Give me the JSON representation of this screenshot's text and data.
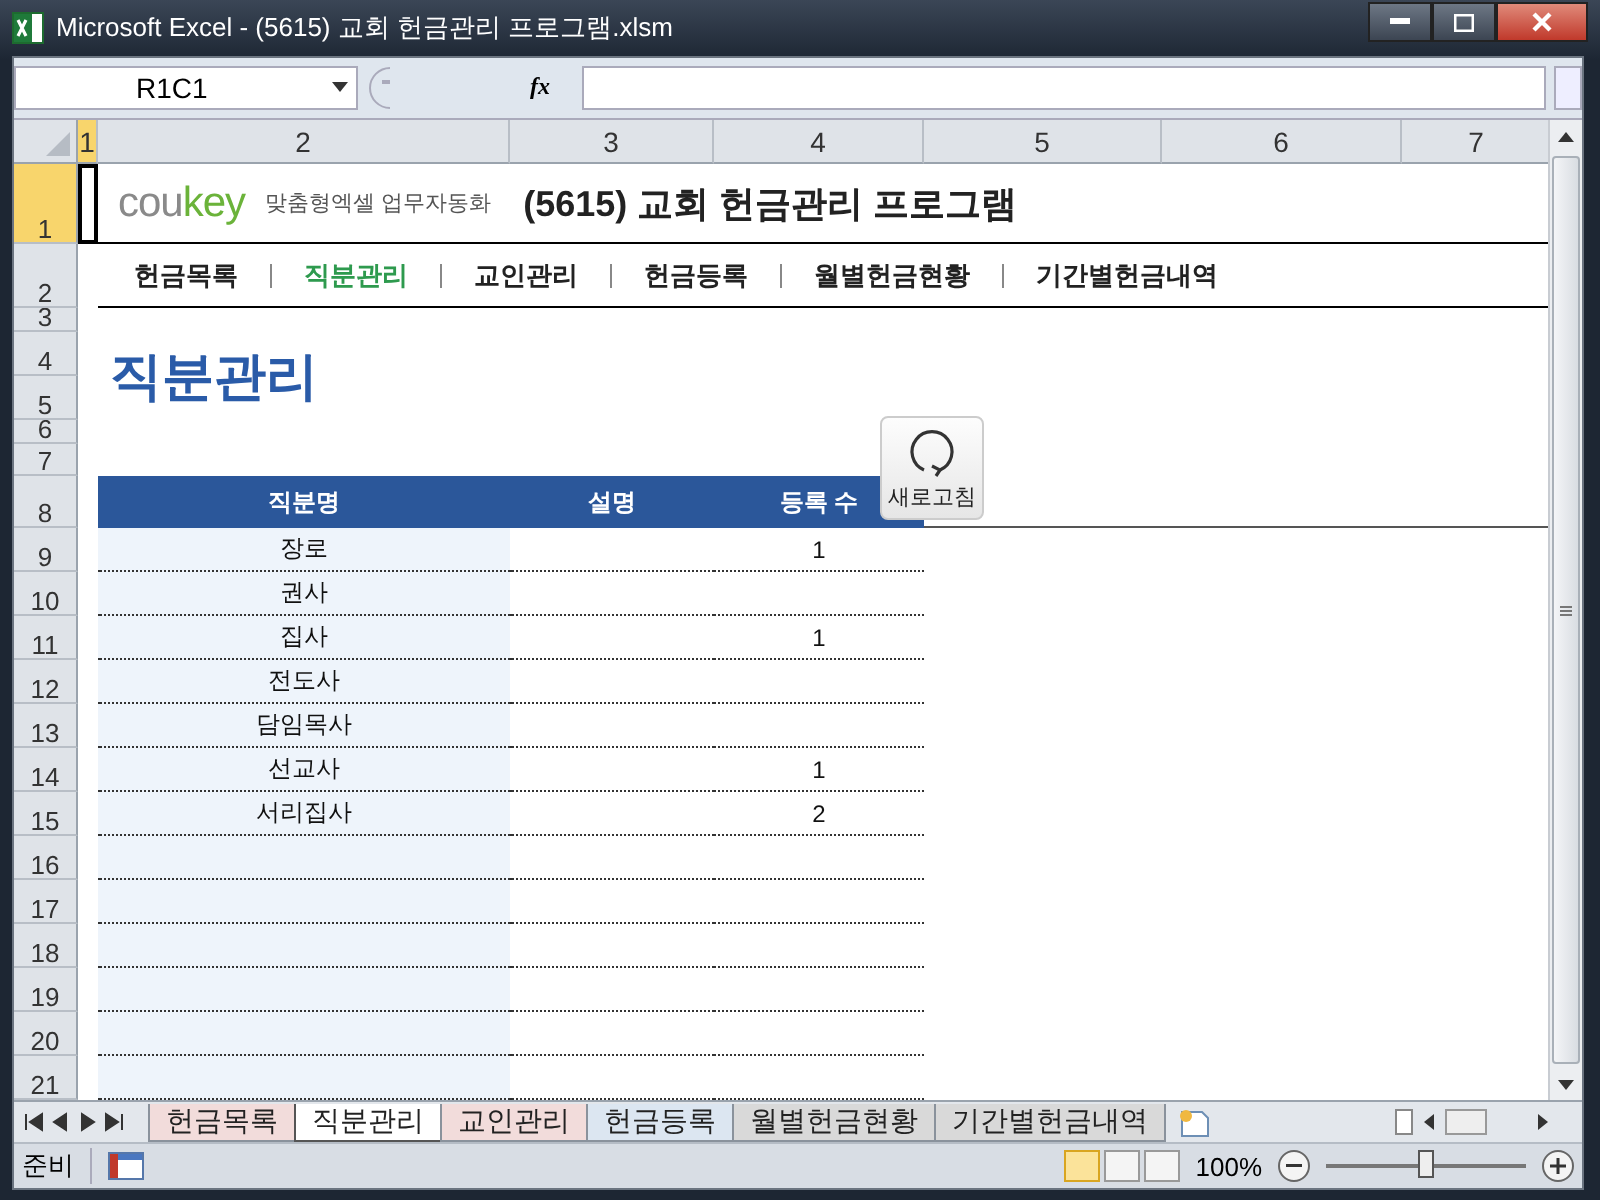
{
  "window": {
    "title": "Microsoft Excel - (5615) 교회 헌금관리 프로그램.xlsm"
  },
  "formula_bar": {
    "name_box": "R1C1",
    "function_label": "fx"
  },
  "column_headers": [
    {
      "label": "1",
      "selected": true
    },
    {
      "label": "2",
      "selected": false
    },
    {
      "label": "3",
      "selected": false
    },
    {
      "label": "4",
      "selected": false
    },
    {
      "label": "5",
      "selected": false
    },
    {
      "label": "6",
      "selected": false
    },
    {
      "label": "7",
      "selected": false
    }
  ],
  "row_headers": [
    {
      "label": "1",
      "selected": true
    },
    {
      "label": "2",
      "selected": false
    },
    {
      "label": "3",
      "selected": false
    },
    {
      "label": "4",
      "selected": false
    },
    {
      "label": "5",
      "selected": false
    },
    {
      "label": "6",
      "selected": false
    },
    {
      "label": "7",
      "selected": false
    },
    {
      "label": "8",
      "selected": false
    },
    {
      "label": "9",
      "selected": false
    },
    {
      "label": "10",
      "selected": false
    },
    {
      "label": "11",
      "selected": false
    },
    {
      "label": "12",
      "selected": false
    },
    {
      "label": "13",
      "selected": false
    },
    {
      "label": "14",
      "selected": false
    },
    {
      "label": "15",
      "selected": false
    },
    {
      "label": "16",
      "selected": false
    },
    {
      "label": "17",
      "selected": false
    },
    {
      "label": "18",
      "selected": false
    },
    {
      "label": "19",
      "selected": false
    },
    {
      "label": "20",
      "selected": false
    },
    {
      "label": "21",
      "selected": false
    }
  ],
  "header": {
    "logo": [
      "cou",
      "key"
    ],
    "tagline": "맞춤형엑셀 업무자동화",
    "title": "(5615) 교회 헌금관리 프로그램"
  },
  "menu": [
    {
      "label": "헌금목록",
      "selected": false
    },
    {
      "label": "직분관리",
      "selected": true
    },
    {
      "label": "교인관리",
      "selected": false
    },
    {
      "label": "헌금등록",
      "selected": false
    },
    {
      "label": "월별헌금현황",
      "selected": false
    },
    {
      "label": "기간별헌금내역",
      "selected": false
    }
  ],
  "page_title": "직분관리",
  "refresh_button": {
    "label": "새로고침"
  },
  "table": {
    "columns": [
      "직분명",
      "설명",
      "등록 수"
    ],
    "rows": [
      {
        "name": "장로",
        "count": "1"
      },
      {
        "name": "권사"
      },
      {
        "name": "집사",
        "count": "1"
      },
      {
        "name": "전도사"
      },
      {
        "name": "담임목사"
      },
      {
        "name": "선교사",
        "count": "1"
      },
      {
        "name": "서리집사",
        "count": "2"
      }
    ]
  },
  "sheet_tabs": [
    {
      "label": "헌금목록",
      "selected": false,
      "color": "#f2dcdb"
    },
    {
      "label": "직분관리",
      "selected": true,
      "color": "#ffffff"
    },
    {
      "label": "교인관리",
      "selected": false,
      "color": "#f2dcdb"
    },
    {
      "label": "헌금등록",
      "selected": false,
      "color": "#dce6f1"
    },
    {
      "label": "월별헌금현황",
      "selected": false,
      "color": "#d9d9d9"
    },
    {
      "label": "기간별헌금내역",
      "selected": false,
      "color": "#d9d9d9"
    }
  ],
  "status_bar": {
    "status": "준비",
    "zoom": "100%",
    "zoom_level": {
      "level": 0.5
    }
  }
}
